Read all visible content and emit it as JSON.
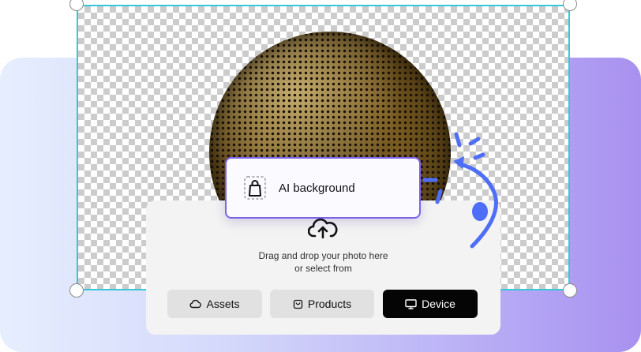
{
  "ai_card": {
    "label": "AI background",
    "icon": "shopping-bag-icon"
  },
  "upload": {
    "icon": "cloud-upload-icon",
    "line1": "Drag and drop your photo here",
    "line2": "or select from"
  },
  "buttons": [
    {
      "label": "Assets",
      "icon": "cloud-icon"
    },
    {
      "label": "Products",
      "icon": "bag-icon"
    },
    {
      "label": "Device",
      "icon": "monitor-icon"
    }
  ],
  "colors": {
    "selection_border": "#38c6d9",
    "accent_purple": "#7b63e8",
    "decoration_blue": "#4f6ef7",
    "dark_button": "#050505"
  }
}
